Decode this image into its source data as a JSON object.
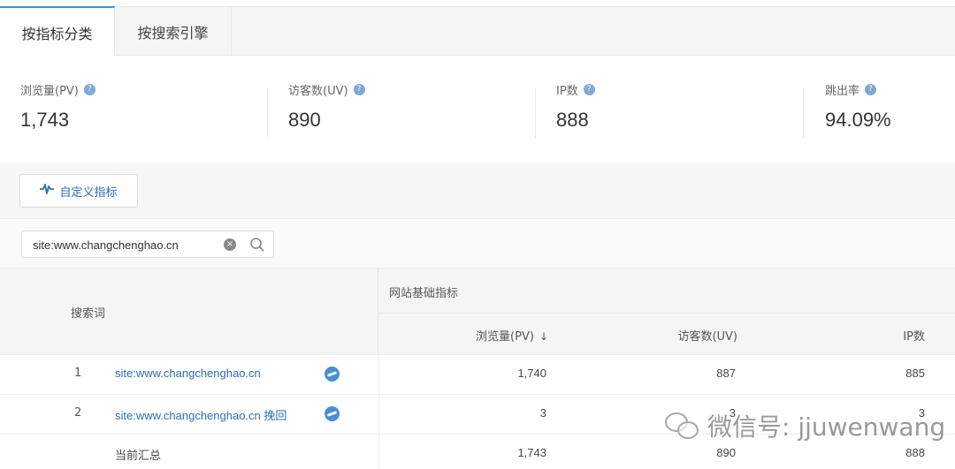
{
  "tabs": [
    {
      "label": "按指标分类",
      "active": true
    },
    {
      "label": "按搜索引擎",
      "active": false
    }
  ],
  "metrics": [
    {
      "label": "浏览量(PV)",
      "value": "1,743"
    },
    {
      "label": "访客数(UV)",
      "value": "890"
    },
    {
      "label": "IP数",
      "value": "888"
    },
    {
      "label": "跳出率",
      "value": "94.09%"
    }
  ],
  "custom_button": {
    "label": "自定义指标",
    "icon": "pulse-icon"
  },
  "search": {
    "value": "site:www.changchenghao.cn"
  },
  "table": {
    "keyword_header": "搜索词",
    "group_header": "网站基础指标",
    "columns": [
      "浏览量(PV)",
      "访客数(UV)",
      "IP数"
    ],
    "sort_indicator": "↓",
    "rows": [
      {
        "index": "1",
        "keyword": "site:www.changchenghao.cn",
        "pv": "1,740",
        "uv": "887",
        "ip": "885"
      },
      {
        "index": "2",
        "keyword": "site:www.changchenghao.cn 挽回",
        "pv": "3",
        "uv": "3",
        "ip": "3"
      }
    ],
    "total": {
      "label": "当前汇总",
      "pv": "1,743",
      "uv": "890",
      "ip": "888"
    }
  },
  "watermark": {
    "text": "微信号: jjuwenwang"
  },
  "colors": {
    "accent": "#3a8ee6",
    "link": "#2f6db5",
    "help_icon": "#7fa8d6"
  }
}
